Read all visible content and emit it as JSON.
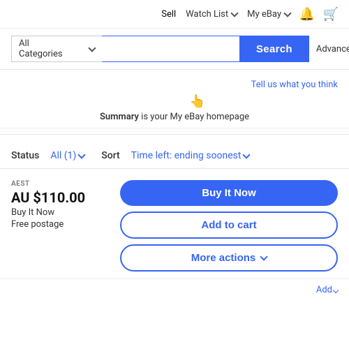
{
  "topNav": {
    "sell": "Sell",
    "watchList": "Watch List",
    "myEbay": "My eBay",
    "bellIcon": "bell",
    "cartIcon": "cart"
  },
  "search": {
    "categoryLabel": "All Categories",
    "buttonLabel": "Search",
    "advancedLabel": "Advanced"
  },
  "summary": {
    "tellUsText": "Tell us what you think",
    "summaryPrefix": "Summary",
    "summaryRest": " is your My eBay homepage"
  },
  "filters": {
    "statusLabel": "Status",
    "statusValue": "All (1)",
    "sortLabel": "Sort",
    "sortValue": "Time left: ending soonest"
  },
  "product": {
    "currencyLabel": "AEST",
    "price": "AU $110.00",
    "buyItNowLabel": "Buy It Now",
    "postageLabel": "Free postage"
  },
  "actions": {
    "buyNow": "Buy It Now",
    "addToCart": "Add to cart",
    "moreActions": "More actions"
  },
  "bottomRow": {
    "addLabel": "Add"
  }
}
